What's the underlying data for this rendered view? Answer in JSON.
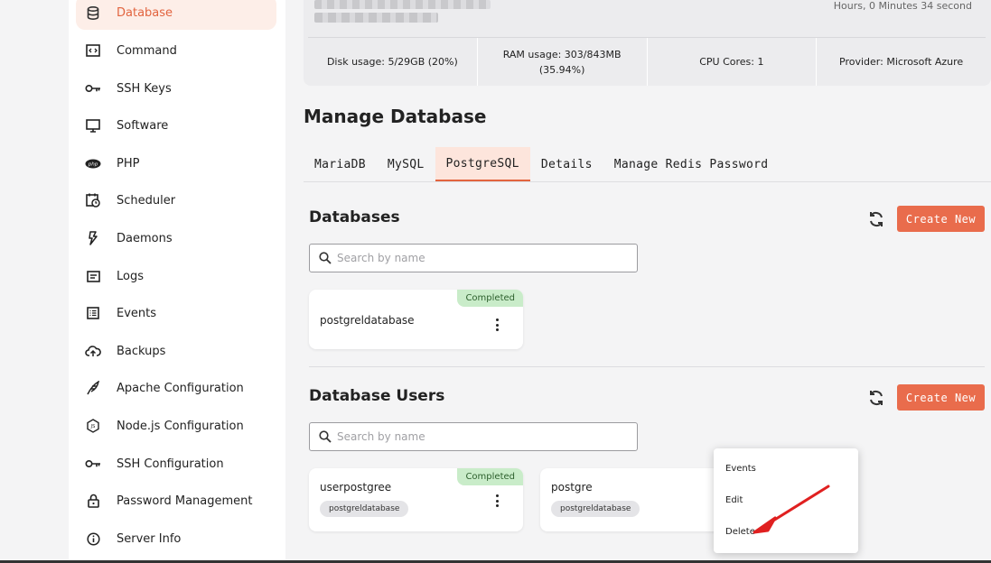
{
  "sidebar": {
    "items": [
      {
        "label": "Database",
        "icon": "database-icon",
        "active": true
      },
      {
        "label": "Command",
        "icon": "terminal-icon"
      },
      {
        "label": "SSH Keys",
        "icon": "key-icon"
      },
      {
        "label": "Software",
        "icon": "monitor-icon"
      },
      {
        "label": "PHP",
        "icon": "php-icon"
      },
      {
        "label": "Scheduler",
        "icon": "calendar-clock-icon"
      },
      {
        "label": "Daemons",
        "icon": "bolt-icon"
      },
      {
        "label": "Logs",
        "icon": "logs-icon"
      },
      {
        "label": "Events",
        "icon": "list-icon"
      },
      {
        "label": "Backups",
        "icon": "cloud-upload-icon"
      },
      {
        "label": "Apache Configuration",
        "icon": "feather-icon"
      },
      {
        "label": "Node.js Configuration",
        "icon": "nodejs-icon"
      },
      {
        "label": "SSH Configuration",
        "icon": "key-icon"
      },
      {
        "label": "Password Management",
        "icon": "lock-icon"
      },
      {
        "label": "Server Info",
        "icon": "info-icon"
      }
    ]
  },
  "server": {
    "uptime": "Hours, 0 Minutes 34 second",
    "stats": {
      "disk": "Disk usage: 5/29GB (20%)",
      "ram_line1": "RAM usage: 303/843MB",
      "ram_line2": "(35.94%)",
      "cpu": "CPU Cores: 1",
      "provider": "Provider: Microsoft Azure"
    }
  },
  "page": {
    "title": "Manage Database"
  },
  "tabs": [
    {
      "label": "MariaDB"
    },
    {
      "label": "MySQL"
    },
    {
      "label": "PostgreSQL",
      "active": true
    },
    {
      "label": "Details"
    },
    {
      "label": "Manage Redis Password"
    }
  ],
  "databases": {
    "title": "Databases",
    "create_label": "Create New",
    "search_placeholder": "Search by name",
    "items": [
      {
        "name": "postgreldatabase",
        "status": "Completed"
      }
    ]
  },
  "users": {
    "title": "Database Users",
    "create_label": "Create New",
    "search_placeholder": "Search by name",
    "items": [
      {
        "name": "userpostgree",
        "status": "Completed",
        "database": "postgreldatabase"
      },
      {
        "name": "postgre",
        "status": "Co",
        "database": "postgreldatabase"
      }
    ]
  },
  "context_menu": {
    "items": [
      "Events",
      "Edit",
      "Delete"
    ]
  },
  "colors": {
    "accent": "#e96c4c",
    "active_tab_bg": "#fde5dc",
    "badge_bg": "#c9ecc9",
    "arrow": "#e02020"
  }
}
